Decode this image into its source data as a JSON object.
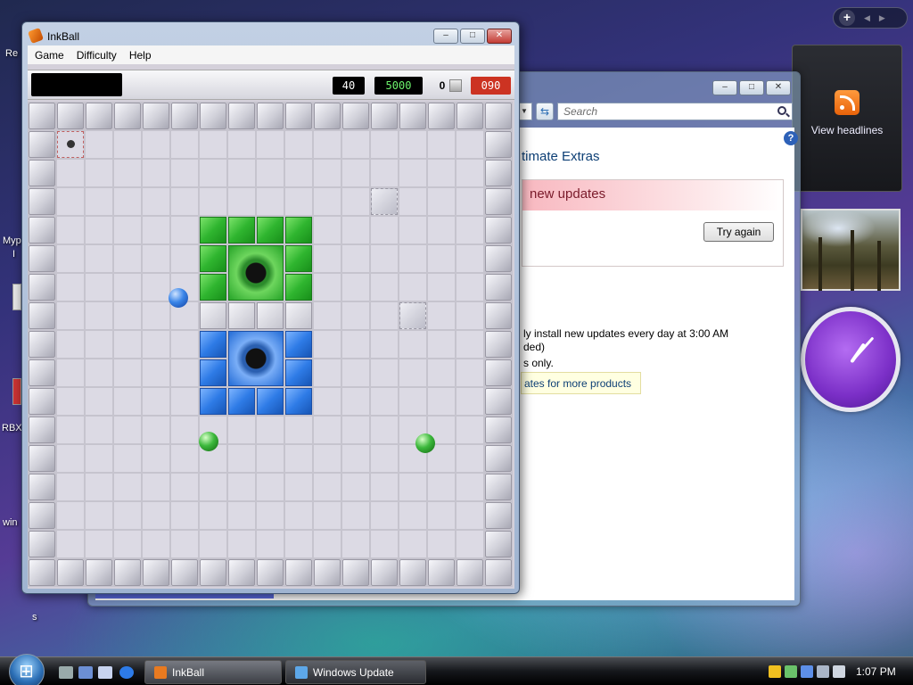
{
  "inkball": {
    "title": "InkBall",
    "menu": [
      "Game",
      "Difficulty",
      "Help"
    ],
    "timer": "40",
    "score": "5000",
    "count": "0",
    "level_code": "090"
  },
  "windows_update": {
    "search_placeholder": "Search",
    "extras_text": "timate Extras",
    "banner_text": "new updates",
    "try_again_label": "Try again",
    "line1": "ly install new updates every day at 3:00 AM",
    "line2": "ded)",
    "line3": "s only.",
    "link_text": "ates for more products"
  },
  "sidebar": {
    "feed_label": "View headlines"
  },
  "desktop_fragments": {
    "re": "Re",
    "myp": "Myp",
    "i": "I",
    "rbx": "RBX",
    "win": "win",
    "s": "s"
  },
  "taskbar": {
    "buttons": [
      "InkBall",
      "Windows Update"
    ],
    "time": "1:07 PM"
  },
  "colors": {
    "green_tile": "#2fb52f",
    "blue_tile": "#2e7be6",
    "red_counter": "#cc3322"
  }
}
